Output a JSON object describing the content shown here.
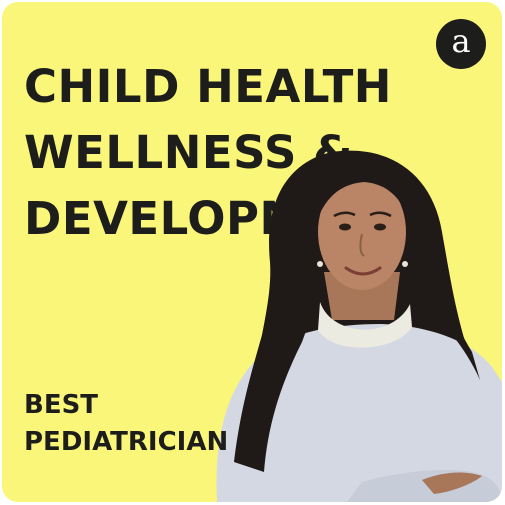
{
  "card": {
    "background": "#faf67a",
    "text_color": "#1d1d1b"
  },
  "logo": {
    "letter": "a",
    "background": "#1d1d1b"
  },
  "headline": {
    "line1": "CHILD HEALTH",
    "line2": "WELLNESS &",
    "line3": "DEVELOPMENT"
  },
  "tagline": {
    "line1": "BEST",
    "line2": "PEDIATRICIAN"
  },
  "portrait": {
    "sweater_color": "#d3d8e3",
    "hair_color": "#1f1a17",
    "skin_color": "#b98566"
  }
}
